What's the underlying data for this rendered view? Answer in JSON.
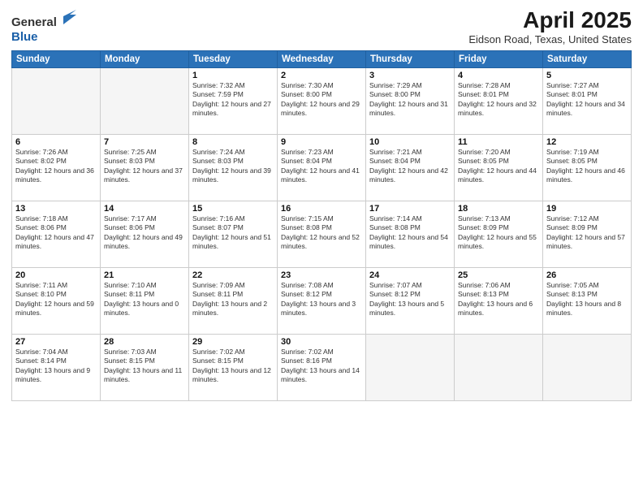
{
  "header": {
    "logo_general": "General",
    "logo_blue": "Blue",
    "title": "April 2025",
    "location": "Eidson Road, Texas, United States"
  },
  "weekdays": [
    "Sunday",
    "Monday",
    "Tuesday",
    "Wednesday",
    "Thursday",
    "Friday",
    "Saturday"
  ],
  "weeks": [
    [
      {
        "day": "",
        "sunrise": "",
        "sunset": "",
        "daylight": ""
      },
      {
        "day": "",
        "sunrise": "",
        "sunset": "",
        "daylight": ""
      },
      {
        "day": "1",
        "sunrise": "Sunrise: 7:32 AM",
        "sunset": "Sunset: 7:59 PM",
        "daylight": "Daylight: 12 hours and 27 minutes."
      },
      {
        "day": "2",
        "sunrise": "Sunrise: 7:30 AM",
        "sunset": "Sunset: 8:00 PM",
        "daylight": "Daylight: 12 hours and 29 minutes."
      },
      {
        "day": "3",
        "sunrise": "Sunrise: 7:29 AM",
        "sunset": "Sunset: 8:00 PM",
        "daylight": "Daylight: 12 hours and 31 minutes."
      },
      {
        "day": "4",
        "sunrise": "Sunrise: 7:28 AM",
        "sunset": "Sunset: 8:01 PM",
        "daylight": "Daylight: 12 hours and 32 minutes."
      },
      {
        "day": "5",
        "sunrise": "Sunrise: 7:27 AM",
        "sunset": "Sunset: 8:01 PM",
        "daylight": "Daylight: 12 hours and 34 minutes."
      }
    ],
    [
      {
        "day": "6",
        "sunrise": "Sunrise: 7:26 AM",
        "sunset": "Sunset: 8:02 PM",
        "daylight": "Daylight: 12 hours and 36 minutes."
      },
      {
        "day": "7",
        "sunrise": "Sunrise: 7:25 AM",
        "sunset": "Sunset: 8:03 PM",
        "daylight": "Daylight: 12 hours and 37 minutes."
      },
      {
        "day": "8",
        "sunrise": "Sunrise: 7:24 AM",
        "sunset": "Sunset: 8:03 PM",
        "daylight": "Daylight: 12 hours and 39 minutes."
      },
      {
        "day": "9",
        "sunrise": "Sunrise: 7:23 AM",
        "sunset": "Sunset: 8:04 PM",
        "daylight": "Daylight: 12 hours and 41 minutes."
      },
      {
        "day": "10",
        "sunrise": "Sunrise: 7:21 AM",
        "sunset": "Sunset: 8:04 PM",
        "daylight": "Daylight: 12 hours and 42 minutes."
      },
      {
        "day": "11",
        "sunrise": "Sunrise: 7:20 AM",
        "sunset": "Sunset: 8:05 PM",
        "daylight": "Daylight: 12 hours and 44 minutes."
      },
      {
        "day": "12",
        "sunrise": "Sunrise: 7:19 AM",
        "sunset": "Sunset: 8:05 PM",
        "daylight": "Daylight: 12 hours and 46 minutes."
      }
    ],
    [
      {
        "day": "13",
        "sunrise": "Sunrise: 7:18 AM",
        "sunset": "Sunset: 8:06 PM",
        "daylight": "Daylight: 12 hours and 47 minutes."
      },
      {
        "day": "14",
        "sunrise": "Sunrise: 7:17 AM",
        "sunset": "Sunset: 8:06 PM",
        "daylight": "Daylight: 12 hours and 49 minutes."
      },
      {
        "day": "15",
        "sunrise": "Sunrise: 7:16 AM",
        "sunset": "Sunset: 8:07 PM",
        "daylight": "Daylight: 12 hours and 51 minutes."
      },
      {
        "day": "16",
        "sunrise": "Sunrise: 7:15 AM",
        "sunset": "Sunset: 8:08 PM",
        "daylight": "Daylight: 12 hours and 52 minutes."
      },
      {
        "day": "17",
        "sunrise": "Sunrise: 7:14 AM",
        "sunset": "Sunset: 8:08 PM",
        "daylight": "Daylight: 12 hours and 54 minutes."
      },
      {
        "day": "18",
        "sunrise": "Sunrise: 7:13 AM",
        "sunset": "Sunset: 8:09 PM",
        "daylight": "Daylight: 12 hours and 55 minutes."
      },
      {
        "day": "19",
        "sunrise": "Sunrise: 7:12 AM",
        "sunset": "Sunset: 8:09 PM",
        "daylight": "Daylight: 12 hours and 57 minutes."
      }
    ],
    [
      {
        "day": "20",
        "sunrise": "Sunrise: 7:11 AM",
        "sunset": "Sunset: 8:10 PM",
        "daylight": "Daylight: 12 hours and 59 minutes."
      },
      {
        "day": "21",
        "sunrise": "Sunrise: 7:10 AM",
        "sunset": "Sunset: 8:11 PM",
        "daylight": "Daylight: 13 hours and 0 minutes."
      },
      {
        "day": "22",
        "sunrise": "Sunrise: 7:09 AM",
        "sunset": "Sunset: 8:11 PM",
        "daylight": "Daylight: 13 hours and 2 minutes."
      },
      {
        "day": "23",
        "sunrise": "Sunrise: 7:08 AM",
        "sunset": "Sunset: 8:12 PM",
        "daylight": "Daylight: 13 hours and 3 minutes."
      },
      {
        "day": "24",
        "sunrise": "Sunrise: 7:07 AM",
        "sunset": "Sunset: 8:12 PM",
        "daylight": "Daylight: 13 hours and 5 minutes."
      },
      {
        "day": "25",
        "sunrise": "Sunrise: 7:06 AM",
        "sunset": "Sunset: 8:13 PM",
        "daylight": "Daylight: 13 hours and 6 minutes."
      },
      {
        "day": "26",
        "sunrise": "Sunrise: 7:05 AM",
        "sunset": "Sunset: 8:13 PM",
        "daylight": "Daylight: 13 hours and 8 minutes."
      }
    ],
    [
      {
        "day": "27",
        "sunrise": "Sunrise: 7:04 AM",
        "sunset": "Sunset: 8:14 PM",
        "daylight": "Daylight: 13 hours and 9 minutes."
      },
      {
        "day": "28",
        "sunrise": "Sunrise: 7:03 AM",
        "sunset": "Sunset: 8:15 PM",
        "daylight": "Daylight: 13 hours and 11 minutes."
      },
      {
        "day": "29",
        "sunrise": "Sunrise: 7:02 AM",
        "sunset": "Sunset: 8:15 PM",
        "daylight": "Daylight: 13 hours and 12 minutes."
      },
      {
        "day": "30",
        "sunrise": "Sunrise: 7:02 AM",
        "sunset": "Sunset: 8:16 PM",
        "daylight": "Daylight: 13 hours and 14 minutes."
      },
      {
        "day": "",
        "sunrise": "",
        "sunset": "",
        "daylight": ""
      },
      {
        "day": "",
        "sunrise": "",
        "sunset": "",
        "daylight": ""
      },
      {
        "day": "",
        "sunrise": "",
        "sunset": "",
        "daylight": ""
      }
    ]
  ]
}
